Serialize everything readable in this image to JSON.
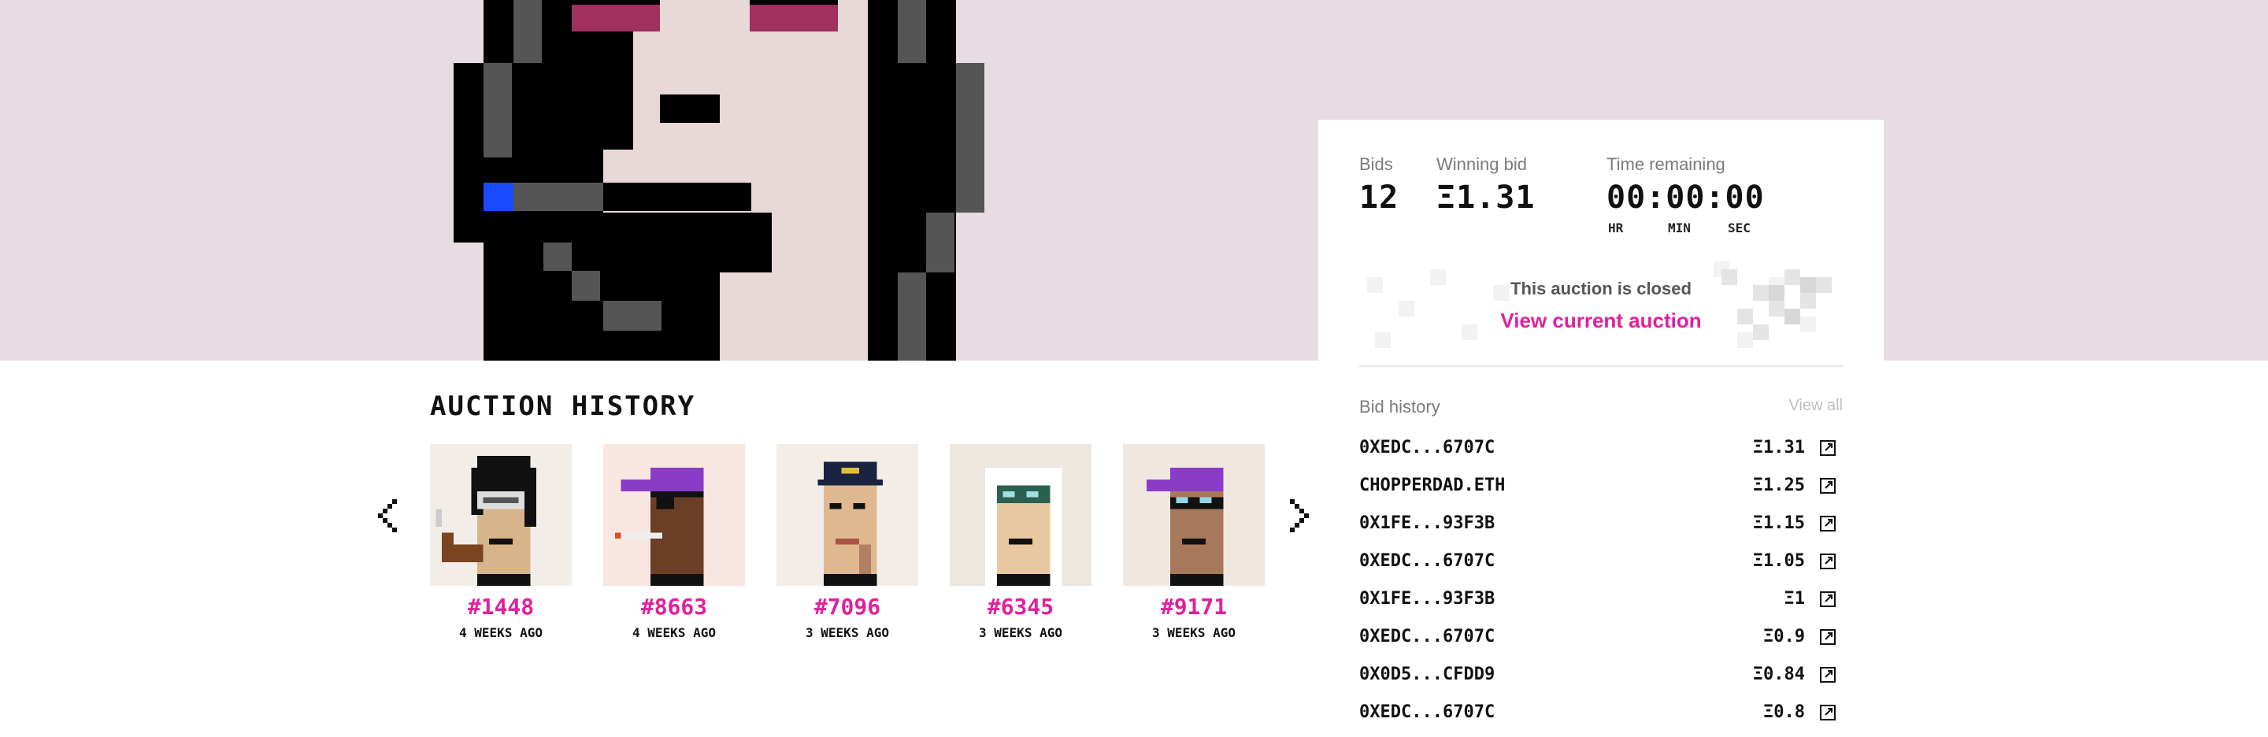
{
  "auction": {
    "bids_label": "Bids",
    "bids_value": "12",
    "winning_label": "Winning bid",
    "winning_value": "Ξ1.31",
    "time_label": "Time remaining",
    "time_value": "00:00:00",
    "time_units": [
      "HR",
      "MIN",
      "SEC"
    ],
    "closed_text": "This auction is closed",
    "view_current_label": "View current auction"
  },
  "bid_history": {
    "title": "Bid history",
    "view_all_label": "View all",
    "bids": [
      {
        "bidder": "0XEDC...6707C",
        "amount": "Ξ1.31"
      },
      {
        "bidder": "CHOPPERDAD.ETH",
        "amount": "Ξ1.25"
      },
      {
        "bidder": "0X1FE...93F3B",
        "amount": "Ξ1.15"
      },
      {
        "bidder": "0XEDC...6707C",
        "amount": "Ξ1.05"
      },
      {
        "bidder": "0X1FE...93F3B",
        "amount": "Ξ1"
      },
      {
        "bidder": "0XEDC...6707C",
        "amount": "Ξ0.9"
      },
      {
        "bidder": "0X0D5...CFDD9",
        "amount": "Ξ0.84"
      },
      {
        "bidder": "0XEDC...6707C",
        "amount": "Ξ0.8"
      }
    ]
  },
  "auction_history": {
    "title": "AUCTION HISTORY",
    "items": [
      {
        "id": "#1448",
        "time": "4 WEEKS AGO"
      },
      {
        "id": "#8663",
        "time": "4 WEEKS AGO"
      },
      {
        "id": "#7096",
        "time": "3 WEEKS AGO"
      },
      {
        "id": "#6345",
        "time": "3 WEEKS AGO"
      },
      {
        "id": "#9171",
        "time": "3 WEEKS AGO"
      }
    ]
  },
  "colors": {
    "accent": "#e0209c",
    "hero_bg": "#e6dce2",
    "text": "#111111"
  },
  "icons": {
    "prev": "chevron-left-icon",
    "next": "chevron-right-icon",
    "external": "external-link-icon"
  }
}
